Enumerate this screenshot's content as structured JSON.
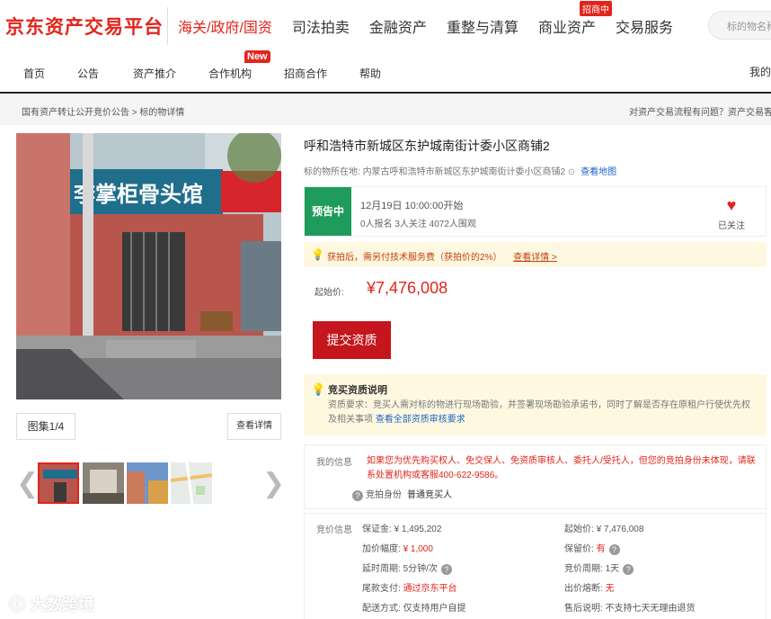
{
  "header": {
    "logo": "京东资产交易平台",
    "nav": [
      "海关/政府/国资",
      "司法拍卖",
      "金融资产",
      "重整与清算",
      "商业资产",
      "交易服务"
    ],
    "recruit_badge": "招商中",
    "search_placeholder": "标的物名称"
  },
  "subnav": {
    "items": [
      "首页",
      "公告",
      "资产推介",
      "合作机构",
      "招商合作",
      "帮助"
    ],
    "new_badge": "New",
    "my_link": "我的"
  },
  "breadcrumb": {
    "path": "国有资产转让公开竞价公告  >  标的物详情",
    "help": "对资产交易流程有问题？资产交易客服"
  },
  "gallery": {
    "album_label": "图集1/4",
    "detail_button": "查看详情",
    "shop_sign": "李掌柜骨头馆",
    "colors": {
      "wall": "#c9746b",
      "sign": "#1f6e8c",
      "road": "#7d7d80"
    }
  },
  "item": {
    "title": "呼和浩特市新城区东护城南街计委小区商铺2",
    "location_label": "标的物所在地:",
    "location": "内蒙古呼和浩特市新城区东护城南街计委小区商铺2",
    "map_link": "查看地图",
    "status": "预告中",
    "start_time": "12月19日 10:00:00开始",
    "counts": "0人报名  3人关注  4072人围观",
    "follow_label": "已关注",
    "fee_notice": "获拍后，需另付技术服务费（获拍价的2%）",
    "fee_more": "查看详情 >",
    "start_price_label": "起始价:",
    "start_price": "¥7,476,008",
    "submit_label": "提交资质"
  },
  "qualification": {
    "title": "竞买资质说明",
    "text": "资质要求：竞买人需对标的物进行现场勘验，并签署现场勘验承诺书，同时了解是否存在原租户行使优先权及相关事项",
    "link": "查看全部资质审核要求"
  },
  "mine": {
    "label": "我的信息",
    "text": "如果您为优先购买权人、免交保人、免资质审核人、委托人/受托人，但您的竞拍身份未体现，请联系处置机构或客服400-622-9586。",
    "identity_label": "竞拍身份",
    "identity_value": "普通竞买人"
  },
  "bid_info": {
    "label": "竞价信息",
    "left": [
      {
        "k": "保证金:",
        "v": "¥ 1,495,202",
        "red": false
      },
      {
        "k": "加价幅度:",
        "v": "¥ 1,000",
        "red": true
      },
      {
        "k": "延时周期:",
        "v": "5分钟/次",
        "red": false,
        "help": true
      },
      {
        "k": "尾款支付:",
        "v": "通过京东平台",
        "red": true
      },
      {
        "k": "配送方式:",
        "v": "仅支持用户自提",
        "red": false
      }
    ],
    "right": [
      {
        "k": "起始价:",
        "v": "¥ 7,476,008",
        "red": false
      },
      {
        "k": "保留价:",
        "v": "有",
        "red": true,
        "help": true
      },
      {
        "k": "竞价周期:",
        "v": "1天",
        "red": false,
        "help": true
      },
      {
        "k": "出价熔断:",
        "v": "无",
        "red": true
      },
      {
        "k": "售后说明:",
        "v": "不支持七天无理由退货",
        "red": false
      }
    ]
  },
  "watermark": "大数跨境"
}
